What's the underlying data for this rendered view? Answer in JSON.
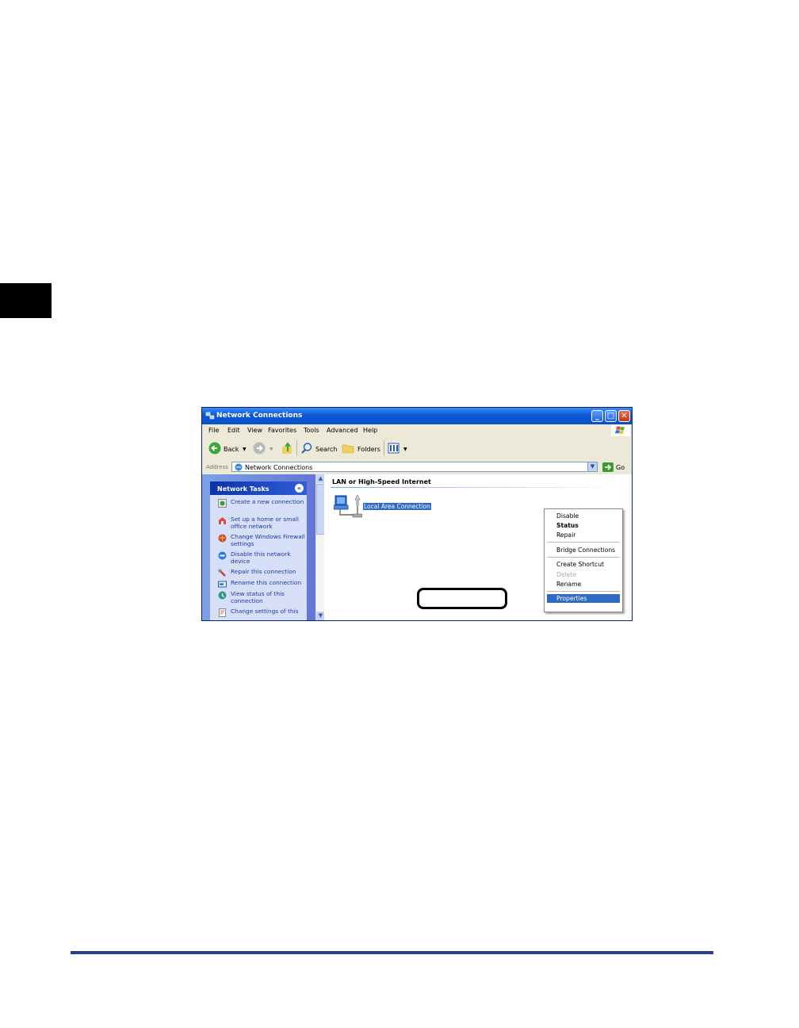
{
  "window": {
    "title": "Network Connections",
    "minimize_glyph": "_",
    "maximize_glyph": "□",
    "close_glyph": "✕"
  },
  "menubar": [
    "File",
    "Edit",
    "View",
    "Favorites",
    "Tools",
    "Advanced",
    "Help"
  ],
  "toolbar": {
    "back_label": "Back",
    "search_label": "Search",
    "folders_label": "Folders"
  },
  "address": {
    "label": "Address",
    "value": "Network Connections",
    "go_label": "Go"
  },
  "task_pane": {
    "header": "Network Tasks",
    "items": [
      "Create a new connection",
      "Set up a home or small office network",
      "Change Windows Firewall settings",
      "Disable this network device",
      "Repair this connection",
      "Rename this connection",
      "View status of this connection",
      "Change settings of this"
    ]
  },
  "main": {
    "group_heading": "LAN or High-Speed Internet",
    "connection_label": "Local Area Connection"
  },
  "context_menu": {
    "items": [
      "Disable",
      "Status",
      "Repair",
      "Bridge Connections",
      "Create Shortcut",
      "Delete",
      "Rename",
      "Properties"
    ],
    "selected": "Properties",
    "disabled": [
      "Delete"
    ],
    "default": "Status"
  },
  "colors": {
    "titlebar": "#0a58d8",
    "selection": "#316ac5",
    "bottom_rule": "#2a3e8f",
    "task_pane": "#6375d6"
  }
}
